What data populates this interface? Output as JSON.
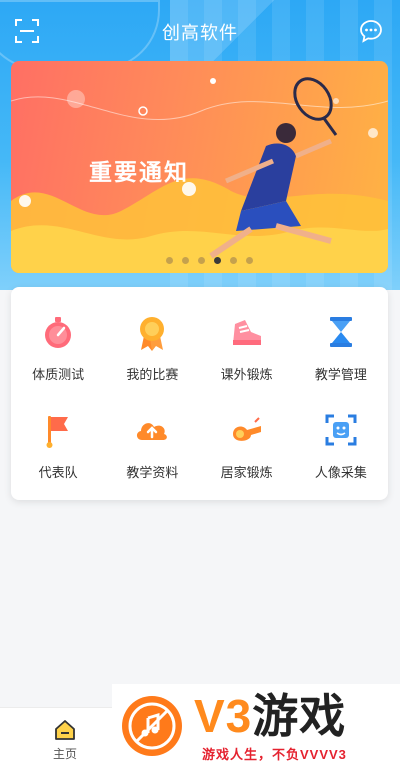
{
  "header": {
    "title": "创高软件"
  },
  "banner": {
    "text": "重要通知",
    "dots_total": 6,
    "dots_active_index": 3
  },
  "menu": {
    "items": [
      {
        "label": "体质测试",
        "icon": "stopwatch-icon"
      },
      {
        "label": "我的比赛",
        "icon": "medal-icon"
      },
      {
        "label": "课外锻炼",
        "icon": "sneaker-icon"
      },
      {
        "label": "教学管理",
        "icon": "hourglass-icon"
      },
      {
        "label": "代表队",
        "icon": "flag-icon"
      },
      {
        "label": "教学资料",
        "icon": "cloud-upload-icon"
      },
      {
        "label": "居家锻炼",
        "icon": "whistle-icon"
      },
      {
        "label": "人像采集",
        "icon": "face-scan-icon"
      }
    ]
  },
  "tabbar": {
    "home_label": "主页"
  },
  "watermark": {
    "brand": "V3",
    "brand_cn": "游戏",
    "slogan": "游戏人生，不负VVVV3"
  },
  "colors": {
    "primary": "#2da8f5",
    "banner": "#ff7a5c",
    "watermark_orange": "#ff8a1d",
    "slogan_red": "#e5222f"
  }
}
